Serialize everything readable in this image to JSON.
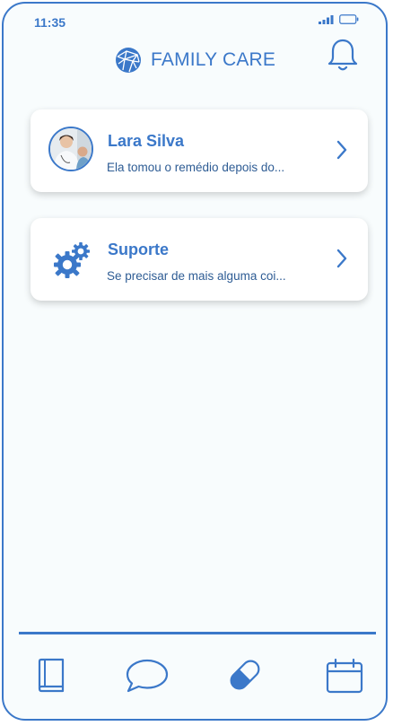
{
  "status_bar": {
    "time": "11:35",
    "signal_icon": "signal-bars-icon",
    "battery_icon": "battery-icon"
  },
  "header": {
    "brand_name": "FAMILY CARE",
    "logo_icon": "globe-logo-icon",
    "bell_icon": "bell-icon"
  },
  "cards": [
    {
      "title": "Lara Silva",
      "subtitle": "Ela tomou o remédio depois do...",
      "icon": "avatar"
    },
    {
      "title": "Suporte",
      "subtitle": "Se precisar de mais alguma coi...",
      "icon": "gears-icon"
    }
  ],
  "bottom_nav": [
    "book-icon",
    "chat-icon",
    "pill-icon",
    "calendar-icon"
  ],
  "colors": {
    "accent": "#3b78c9",
    "background": "#f8fcfd",
    "card": "#ffffff"
  }
}
